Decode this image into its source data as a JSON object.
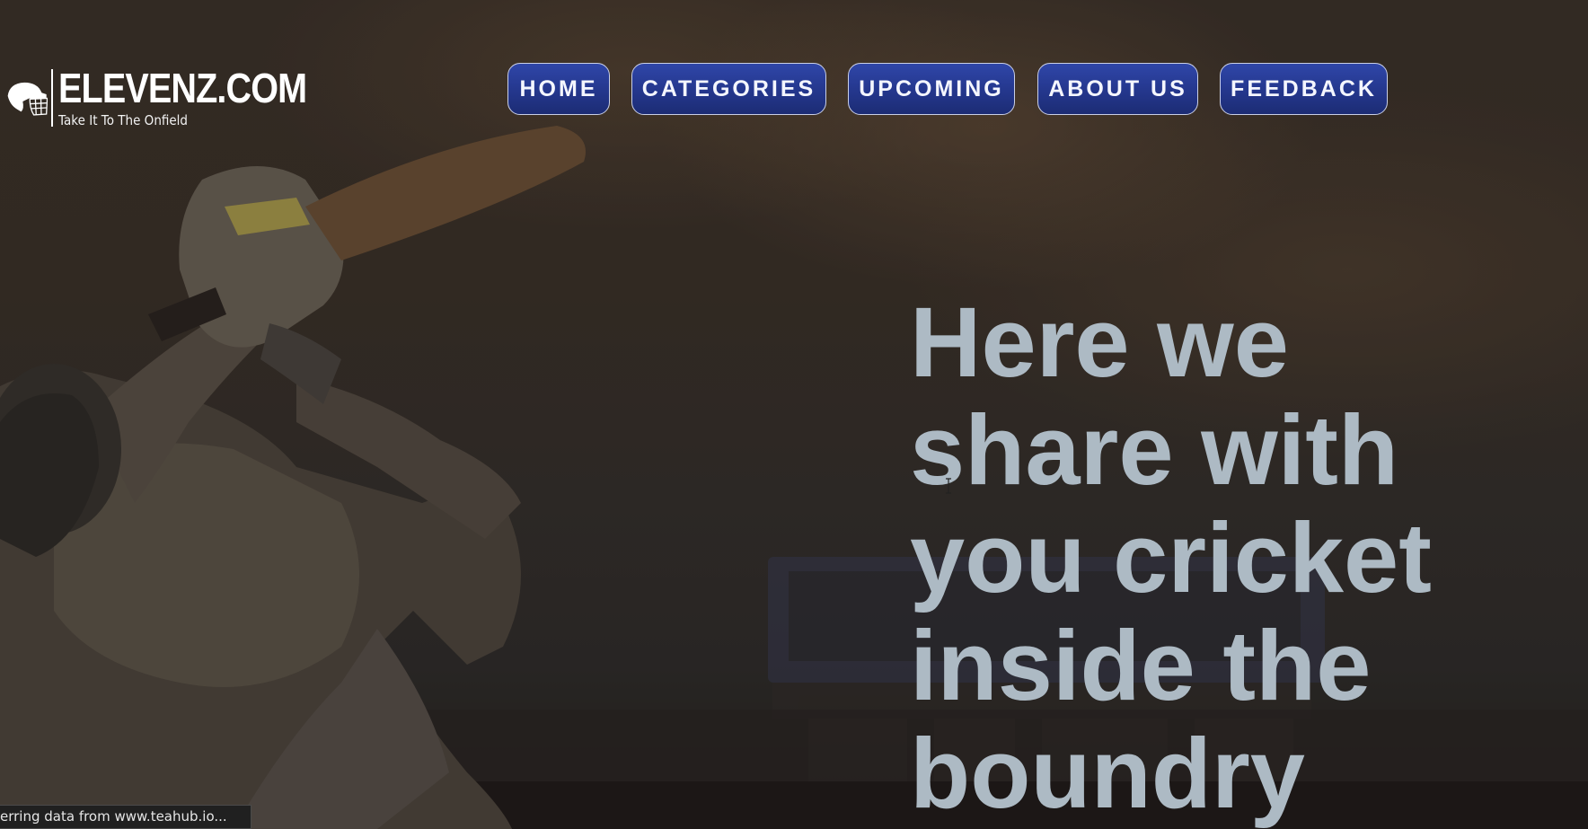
{
  "brand": {
    "name": "ELEVENZ.COM",
    "tagline": "Take It To The Onfield",
    "logo_icon": "cricket-helmet-icon"
  },
  "nav": {
    "items": [
      {
        "label": "HOME"
      },
      {
        "label": "CATEGORIES"
      },
      {
        "label": "UPCOMING"
      },
      {
        "label": "ABOUT US"
      },
      {
        "label": "FEEDBACK"
      }
    ]
  },
  "hero": {
    "headline_lines": [
      "Here we",
      "share with",
      "you cricket",
      "inside the",
      "boundry"
    ]
  },
  "status_bar": {
    "text": "erring data from www.teahub.io..."
  },
  "colors": {
    "nav_button_bg": "#25388f",
    "nav_button_border": "#c9cfe6",
    "headline": "#adbac4",
    "background": "#2f2d2b"
  }
}
